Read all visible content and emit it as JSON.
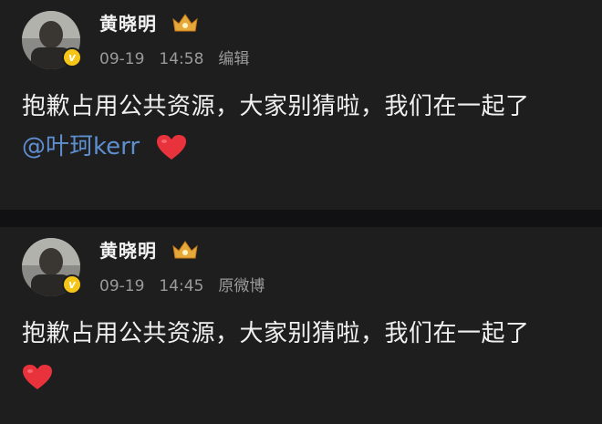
{
  "posts": [
    {
      "author": "黄晓明",
      "date": "09-19",
      "time": "14:58",
      "action": "编辑",
      "text": "抱歉占用公共资源，大家别猜啦，我们在一起了",
      "mention": "@叶珂kerr",
      "emoji": "heart-emoji"
    },
    {
      "author": "黄晓明",
      "date": "09-19",
      "time": "14:45",
      "action": "原微博",
      "text": "抱歉占用公共资源，大家别猜啦，我们在一起了",
      "emoji": "heart-emoji"
    }
  ],
  "badge": {
    "label": "v",
    "color": "#f5c518"
  },
  "colors": {
    "background": "#111113",
    "card": "#1e1e1f",
    "mention": "#5f8fcf",
    "heart": "#e8323c",
    "meta": "#9a9a9a"
  }
}
